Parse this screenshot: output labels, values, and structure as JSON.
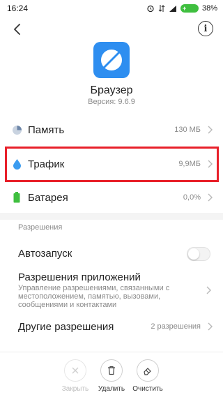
{
  "status_bar": {
    "time": "16:24",
    "battery_percent": "38%"
  },
  "app": {
    "name": "Браузер",
    "version": "Версия: 9.6.9"
  },
  "storage_rows": [
    {
      "label": "Память",
      "value": "130 МБ"
    },
    {
      "label": "Трафик",
      "value": "9,9МБ"
    },
    {
      "label": "Батарея",
      "value": "0,0%"
    }
  ],
  "permissions": {
    "section_title": "Разрешения",
    "autostart_label": "Автозапуск",
    "autostart_enabled": false,
    "app_permissions_title": "Разрешения приложений",
    "app_permissions_desc": "Управление разрешениями, связанными с местоположением, памятью, вызовами, сообщениями и контактами",
    "other_label": "Другие разрешения",
    "other_value": "2 разрешения"
  },
  "bottom_actions": [
    {
      "label": "Закрыть",
      "icon": "close-icon",
      "enabled": false
    },
    {
      "label": "Удалить",
      "icon": "trash-icon",
      "enabled": true
    },
    {
      "label": "Очистить",
      "icon": "eraser-icon",
      "enabled": true
    }
  ],
  "colors": {
    "accent_blue": "#2e8ef0",
    "highlight_red": "#e8202a",
    "battery_green": "#3fbf3f",
    "traffic_drop": "#3b9cf0"
  }
}
